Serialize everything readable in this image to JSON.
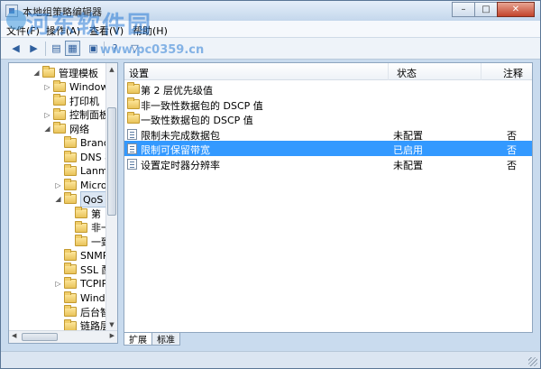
{
  "window": {
    "title": "本地组策略编辑器",
    "caption": {
      "minimize": "–",
      "maximize": "□",
      "close": "✕"
    }
  },
  "watermark": {
    "text": "河东软件园",
    "url": "www.pc0359.cn"
  },
  "menu": [
    "文件(F)",
    "操作(A)",
    "查看(V)",
    "帮助(H)"
  ],
  "toolbar": {
    "buttons": [
      {
        "name": "back-arrow-icon",
        "glyph": "◀"
      },
      {
        "name": "forward-arrow-icon",
        "glyph": "▶"
      },
      {
        "name": "folder-icon",
        "glyph": "▤"
      },
      {
        "name": "show-hide-tree-icon",
        "glyph": "▦"
      },
      {
        "name": "export-list-icon",
        "glyph": "▣"
      },
      {
        "name": "help-icon",
        "glyph": "?"
      },
      {
        "name": "filter-icon",
        "glyph": "▽"
      }
    ]
  },
  "tree": [
    {
      "label": "管理模板",
      "level": 0,
      "expander": "◢",
      "folder": true
    },
    {
      "label": "Windows",
      "level": 1,
      "expander": "▷",
      "folder": true
    },
    {
      "label": "打印机",
      "level": 1,
      "expander": "",
      "folder": true
    },
    {
      "label": "控制面板",
      "level": 1,
      "expander": "▷",
      "folder": true
    },
    {
      "label": "网络",
      "level": 1,
      "expander": "◢",
      "folder": true
    },
    {
      "label": "Branch",
      "level": 2,
      "expander": "",
      "folder": true
    },
    {
      "label": "DNS 客",
      "level": 2,
      "expander": "",
      "folder": true
    },
    {
      "label": "Lanma",
      "level": 2,
      "expander": "",
      "folder": true
    },
    {
      "label": "Micro",
      "level": 2,
      "expander": "▷",
      "folder": true
    },
    {
      "label": "QoS 数",
      "level": 2,
      "expander": "◢",
      "folder": true,
      "selected": true
    },
    {
      "label": "第",
      "level": 3,
      "expander": "",
      "folder": true
    },
    {
      "label": "非一",
      "level": 3,
      "expander": "",
      "folder": true
    },
    {
      "label": "一致",
      "level": 3,
      "expander": "",
      "folder": true
    },
    {
      "label": "SNMP",
      "level": 2,
      "expander": "",
      "folder": true
    },
    {
      "label": "SSL 配",
      "level": 2,
      "expander": "",
      "folder": true
    },
    {
      "label": "TCPIP",
      "level": 2,
      "expander": "▷",
      "folder": true
    },
    {
      "label": "Windo",
      "level": 2,
      "expander": "",
      "folder": true
    },
    {
      "label": "后台智",
      "level": 2,
      "expander": "",
      "folder": true
    },
    {
      "label": "链路层",
      "level": 2,
      "expander": "",
      "folder": true
    }
  ],
  "list": {
    "columns": {
      "setting": "设置",
      "state": "状态",
      "comment": "注释"
    },
    "rows": [
      {
        "name": "第 2 层优先级值",
        "type": "folder",
        "state": "",
        "note": ""
      },
      {
        "name": "非一致性数据包的 DSCP 值",
        "type": "folder",
        "state": "",
        "note": ""
      },
      {
        "name": "一致性数据包的 DSCP 值",
        "type": "folder",
        "state": "",
        "note": ""
      },
      {
        "name": "限制未完成数据包",
        "type": "setting",
        "state": "未配置",
        "note": "否"
      },
      {
        "name": "限制可保留带宽",
        "type": "setting",
        "state": "已启用",
        "note": "否",
        "selected": true
      },
      {
        "name": "设置定时器分辨率",
        "type": "setting",
        "state": "未配置",
        "note": "否"
      }
    ]
  },
  "tabs": [
    "扩展",
    "标准"
  ],
  "colors": {
    "selection": "#3399ff",
    "frame": "#c9dbee"
  }
}
